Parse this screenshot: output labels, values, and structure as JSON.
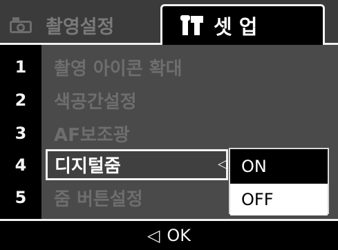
{
  "tabs": {
    "shooting_label": "촬영설정",
    "setup_label": "셋 업"
  },
  "menu": {
    "items": [
      {
        "num": "1",
        "label": "촬영 아이콘 확대"
      },
      {
        "num": "2",
        "label": "색공간설정"
      },
      {
        "num": "3",
        "label": "AF보조광"
      },
      {
        "num": "4",
        "label": "디지털줌"
      },
      {
        "num": "5",
        "label": "줌 버튼설정"
      }
    ],
    "selected_index": 3
  },
  "submenu": {
    "options": [
      "ON",
      "OFF"
    ],
    "highlighted": "OFF"
  },
  "footer": {
    "ok_label": "OK"
  },
  "icons": {
    "shooting": "camera-icon",
    "setup": "tools-icon",
    "back": "left-triangle-icon"
  },
  "colors": {
    "highlight_bg": "#ffffff",
    "background": "#4a4a4a",
    "active_tab": "#000000"
  }
}
